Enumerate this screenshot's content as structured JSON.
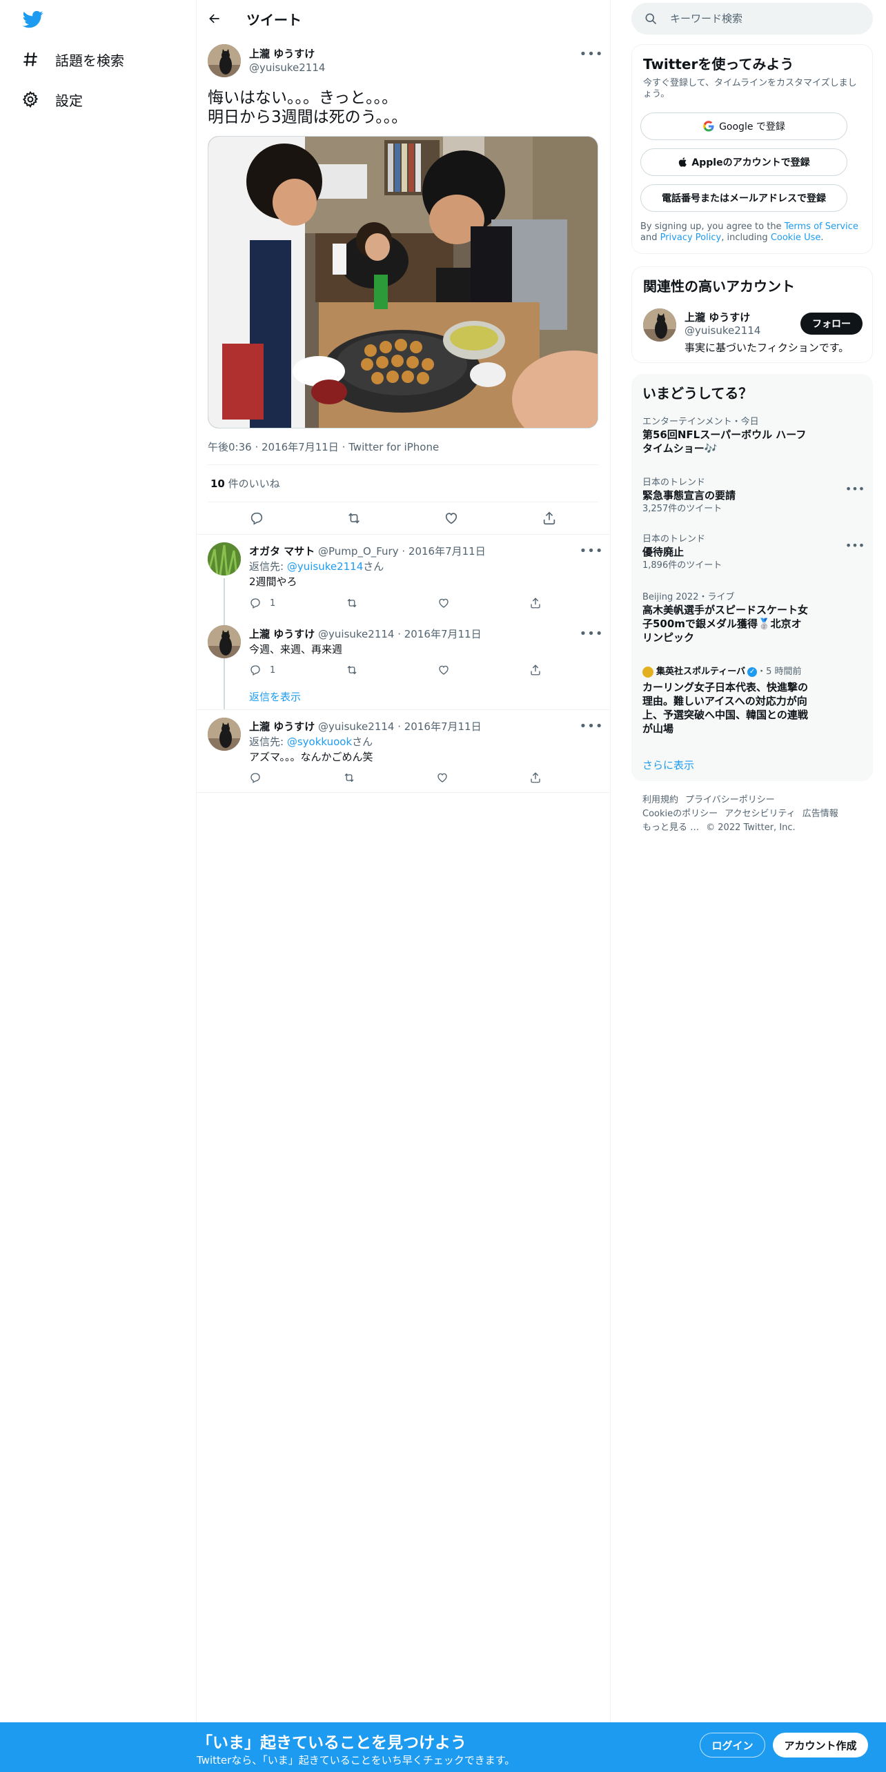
{
  "nav": {
    "items": [
      {
        "label": "話題を検索",
        "icon": "hashtag-icon"
      },
      {
        "label": "設定",
        "icon": "gear-icon"
      }
    ]
  },
  "header": {
    "title": "ツイート"
  },
  "tweet": {
    "name": "上瀧 ゆうすけ",
    "handle": "@yuisuke2114",
    "text": "悔いはない。。。きっと。。。\n明日から3週間は死のう。。。",
    "time": "午後0:36",
    "date": "2016年7月11日",
    "source": "Twitter for iPhone",
    "likes_count": "10",
    "likes_label": " 件のいいね"
  },
  "replies": [
    {
      "name": "オガタ マサト",
      "handle": "@Pump_O_Fury",
      "date": "2016年7月11日",
      "reply_prefix": "返信先: ",
      "reply_to": "@yuisuke2114",
      "reply_suffix": "さん",
      "text": "2週間やろ",
      "reply_count": "1"
    },
    {
      "name": "上瀧 ゆうすけ",
      "handle": "@yuisuke2114",
      "date": "2016年7月11日",
      "text": "今週、来週、再来週",
      "reply_count": "1",
      "show_replies": "返信を表示"
    },
    {
      "name": "上瀧 ゆうすけ",
      "handle": "@yuisuke2114",
      "date": "2016年7月11日",
      "reply_prefix": "返信先: ",
      "reply_to": "@syokkuook",
      "reply_suffix": "さん",
      "text": "アズマ。。。なんかごめん笑"
    }
  ],
  "search": {
    "placeholder": "キーワード検索"
  },
  "signup": {
    "title": "Twitterを使ってみよう",
    "subtitle": "今すぐ登録して、タイムラインをカスタマイズしましょう。",
    "google": "Google で登録",
    "apple": "Appleのアカウントで登録",
    "phone": "電話番号またはメールアドレスで登録",
    "legal_1": "By signing up, you agree to the ",
    "terms": "Terms of Service",
    "legal_2": " and ",
    "privacy": "Privacy Policy",
    "legal_3": ", including ",
    "cookie": "Cookie Use",
    "legal_4": "."
  },
  "related": {
    "title": "関連性の高いアカウント",
    "name": "上瀧 ゆうすけ",
    "handle": "@yuisuke2114",
    "bio": "事実に基づいたフィクションです。",
    "follow": "フォロー"
  },
  "trends": {
    "title": "いまどうしてる？",
    "items": [
      {
        "meta": "エンターテインメント・今日",
        "name": "第56回NFLスーパーボウル ハーフタイムショー🎶",
        "count": ""
      },
      {
        "meta": "日本のトレンド",
        "name": "緊急事態宣言の要請",
        "count": "3,257件のツイート"
      },
      {
        "meta": "日本のトレンド",
        "name": "優待廃止",
        "count": "1,896件のツイート"
      },
      {
        "meta": "Beijing 2022・ライブ",
        "name": "高木美帆選手がスピードスケート女子500mで銀メダル獲得🥈北京オリンピック",
        "count": ""
      },
      {
        "meta_source": "集英社スポルティーバ",
        "meta_time": "・5 時間前",
        "name": "カーリング女子日本代表、快進撃の理由。難しいアイスへの対応力が向上、予選突破へ中国、韓国との連戦が山場",
        "count": ""
      }
    ],
    "show_more": "さらに表示"
  },
  "footer": {
    "links": [
      "利用規約",
      "プライバシーポリシー",
      "Cookieのポリシー",
      "アクセシビリティ",
      "広告情報",
      "もっと見る …"
    ],
    "copyright": "© 2022 Twitter, Inc."
  },
  "bottom": {
    "title": "「いま」起きていることを見つけよう",
    "subtitle": "Twitterなら、「いま」起きていることをいち早くチェックできます。",
    "login": "ログイン",
    "signup": "アカウント作成"
  },
  "colors": {
    "accent": "#1d9bf0",
    "text": "#0f1419",
    "secondary": "#536471"
  }
}
